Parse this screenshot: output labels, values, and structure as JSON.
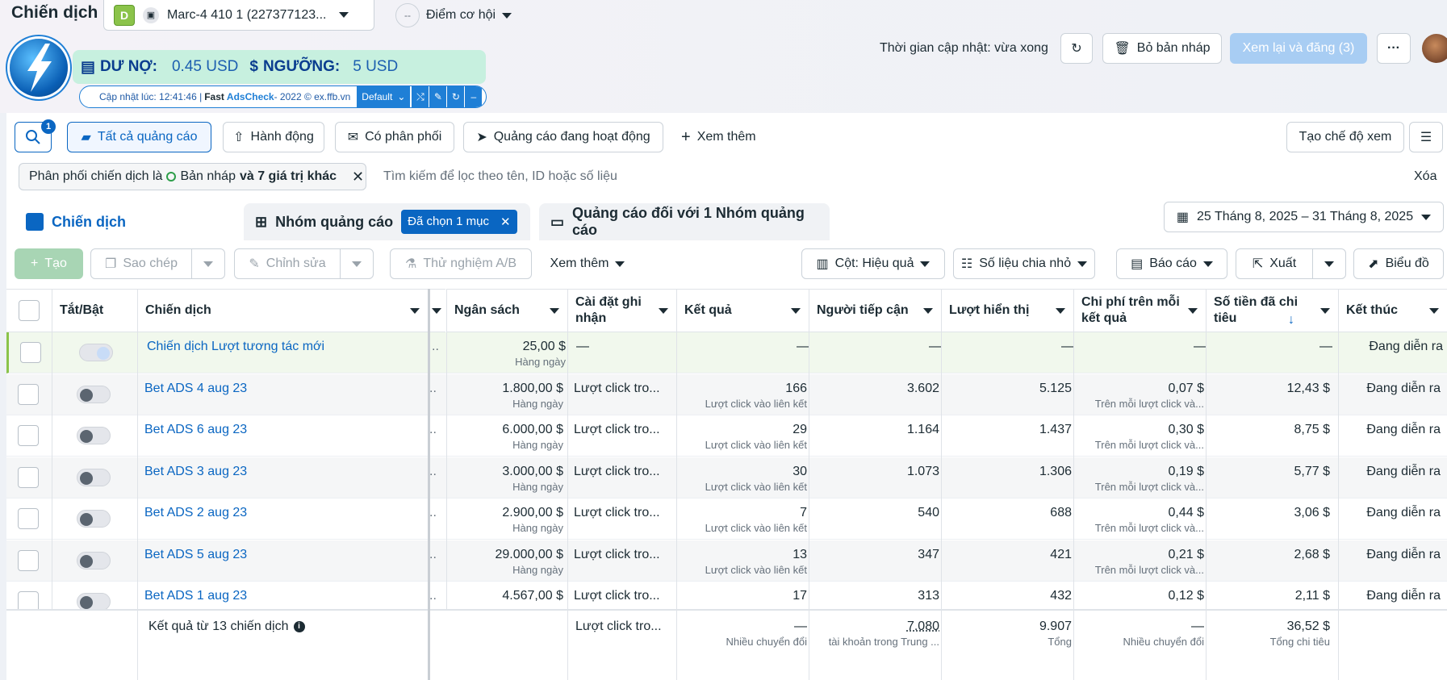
{
  "header": {
    "title": "Chiến dịch",
    "account_badge": "D",
    "account_name": "Marc-4 410 1 (227377123...",
    "opportunity_score_value": "--",
    "opportunity_score": "Điểm cơ hội",
    "update_time": "Thời gian cập nhật: vừa xong",
    "discard_label": "Bỏ bản nháp",
    "publish_label": "Xem lại và đăng (3)"
  },
  "extension": {
    "debt_label": "DƯ NỢ:",
    "debt_value": "0.45 USD",
    "threshold_label": "NGƯỠNG:",
    "threshold_value": "5 USD",
    "updated_prefix": "Cập nhật lúc: 12:41:46 | ",
    "brand_fast": "Fast",
    "brand_ads": "AdsCheck",
    "suffix": " - 2022 © ex.ffb.vn",
    "profile": "Default"
  },
  "filters": {
    "search_badge": "1",
    "all_ads": "Tất cả quảng cáo",
    "actions": "Hành động",
    "delivery": "Có phân phối",
    "active_ads": "Quảng cáo đang hoạt động",
    "more": "Xem thêm",
    "create_view": "Tạo chế độ xem",
    "filter_text_a": "Phân phối chiến dịch là",
    "filter_text_b": "Bản nháp",
    "filter_text_c": "và 7 giá trị khác",
    "search_placeholder": "Tìm kiếm để lọc theo tên, ID hoặc số liệu",
    "clear": "Xóa"
  },
  "tabs": {
    "campaigns": "Chiến dịch",
    "adsets": "Nhóm quảng cáo",
    "selected": "Đã chọn 1 mục",
    "ads": "Quảng cáo đối với 1 Nhóm quảng cáo",
    "date_range": "25 Tháng 8, 2025 – 31 Tháng 8, 2025"
  },
  "toolbar": {
    "create": "Tạo",
    "copy": "Sao chép",
    "edit": "Chỉnh sửa",
    "ab_test": "Thử nghiệm A/B",
    "more": "Xem thêm",
    "columns": "Cột: Hiệu quả",
    "breakdown": "Số liệu chia nhỏ",
    "reports": "Báo cáo",
    "export": "Xuất",
    "chart": "Biểu đồ"
  },
  "columns": {
    "toggle": "Tắt/Bật",
    "campaign": "Chiến dịch",
    "budget": "Ngân sách",
    "attribution": "Cài đặt ghi nhận",
    "results": "Kết quả",
    "reach": "Người tiếp cận",
    "impressions": "Lượt hiển thị",
    "cost_per_result": "Chi phí trên mỗi kết quả",
    "amount_spent": "Số tiền đã chi tiêu",
    "ends": "Kết thúc"
  },
  "rows": [
    {
      "name": "Chiến dịch Lượt tương tác mới",
      "budget": "25,00 $",
      "budget_sub": "Hàng ngày",
      "attribution": "—",
      "results": "—",
      "results_sub": "",
      "reach": "—",
      "impressions": "—",
      "cpr": "—",
      "cpr_sub": "",
      "spent": "—",
      "ends": "Đang diễn ra"
    },
    {
      "name": "Bet ADS 4 aug 23",
      "budget": "1.800,00 $",
      "budget_sub": "Hàng ngày",
      "attribution": "Lượt click tro...",
      "results": "166",
      "results_sub": "Lượt click vào liên kết",
      "reach": "3.602",
      "impressions": "5.125",
      "cpr": "0,07 $",
      "cpr_sub": "Trên mỗi lượt click và...",
      "spent": "12,43 $",
      "ends": "Đang diễn ra"
    },
    {
      "name": "Bet ADS 6 aug 23",
      "budget": "6.000,00 $",
      "budget_sub": "Hàng ngày",
      "attribution": "Lượt click tro...",
      "results": "29",
      "results_sub": "Lượt click vào liên kết",
      "reach": "1.164",
      "impressions": "1.437",
      "cpr": "0,30 $",
      "cpr_sub": "Trên mỗi lượt click và...",
      "spent": "8,75 $",
      "ends": "Đang diễn ra"
    },
    {
      "name": "Bet ADS 3 aug 23",
      "budget": "3.000,00 $",
      "budget_sub": "Hàng ngày",
      "attribution": "Lượt click tro...",
      "results": "30",
      "results_sub": "Lượt click vào liên kết",
      "reach": "1.073",
      "impressions": "1.306",
      "cpr": "0,19 $",
      "cpr_sub": "Trên mỗi lượt click và...",
      "spent": "5,77 $",
      "ends": "Đang diễn ra"
    },
    {
      "name": "Bet ADS 2 aug 23",
      "budget": "2.900,00 $",
      "budget_sub": "Hàng ngày",
      "attribution": "Lượt click tro...",
      "results": "7",
      "results_sub": "Lượt click vào liên kết",
      "reach": "540",
      "impressions": "688",
      "cpr": "0,44 $",
      "cpr_sub": "Trên mỗi lượt click và...",
      "spent": "3,06 $",
      "ends": "Đang diễn ra"
    },
    {
      "name": "Bet ADS 5 aug 23",
      "budget": "29.000,00 $",
      "budget_sub": "Hàng ngày",
      "attribution": "Lượt click tro...",
      "results": "13",
      "results_sub": "Lượt click vào liên kết",
      "reach": "347",
      "impressions": "421",
      "cpr": "0,21 $",
      "cpr_sub": "Trên mỗi lượt click và...",
      "spent": "2,68 $",
      "ends": "Đang diễn ra"
    },
    {
      "name": "Bet ADS 1 aug 23",
      "budget": "4.567,00 $",
      "budget_sub": "",
      "attribution": "Lượt click tro...",
      "results": "17",
      "results_sub": "",
      "reach": "313",
      "impressions": "432",
      "cpr": "0,12 $",
      "cpr_sub": "",
      "spent": "2,11 $",
      "ends": "Đang diễn ra"
    }
  ],
  "summary": {
    "label": "Kết quả từ 13 chiến dịch",
    "attribution": "Lượt click tro...",
    "results": "—",
    "results_sub": "Nhiều chuyển đổi",
    "reach": "7.080",
    "reach_sub": "tài khoản trong Trung ...",
    "impressions": "9.907",
    "impressions_sub": "Tổng",
    "cpr": "—",
    "cpr_sub": "Nhiều chuyển đổi",
    "spent": "36,52 $",
    "spent_sub": "Tổng chi tiêu"
  }
}
